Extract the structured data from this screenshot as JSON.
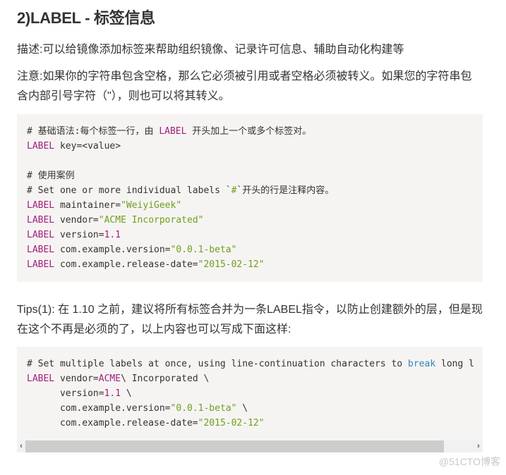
{
  "heading": "2)LABEL - 标签信息",
  "description": "描述:可以给镜像添加标签来帮助组织镜像、记录许可信息、辅助自动化构建等",
  "note": "注意:如果你的字符串包含空格，那么它必须被引用或者空格必须被转义。如果您的字符串包含内部引号字符（\"），则也可以将其转义。",
  "code1": {
    "l1_comment": "# 基础语法:每个标签一行，由 ",
    "l1_kw": "LABEL",
    "l1_rest": " 开头加上一个或多个标签对。",
    "l2_kw": "LABEL",
    "l2_rest": " key=<value>",
    "l4": "# 使用案例",
    "l5_a": "# Set one or more individual labels `",
    "l5_b": "#",
    "l5_c": "`开头的行是注释内容。",
    "lines": [
      {
        "kw": "LABEL",
        "key": " maintainer=",
        "val": "\"WeiyiGeek\""
      },
      {
        "kw": "LABEL",
        "key": " vendor=",
        "val": "\"ACME Incorporated\""
      },
      {
        "kw": "LABEL",
        "key": " version=",
        "val": "1.1"
      },
      {
        "kw": "LABEL",
        "key": " com.example.version=",
        "val": "\"0.0.1-beta\""
      },
      {
        "kw": "LABEL",
        "key": " com.example.release-date=",
        "val": "\"2015-02-12\""
      }
    ]
  },
  "tips": "Tips(1): 在 1.10 之前，建议将所有标签合并为一条LABEL指令，以防止创建额外的层，但是现在这个不再是必须的了，以上内容也可以写成下面这样:",
  "code2": {
    "l1_a": "# Set multiple labels at once, using line-continuation characters to ",
    "l1_b": "break",
    "l1_c": " long l",
    "l2_kw": "LABEL",
    "l2_a": " vendor=",
    "l2_b": "ACME",
    "l2_c": "\\ Incorporated \\",
    "l3_a": "      version=",
    "l3_b": "1.1",
    "l3_c": " \\",
    "l4_a": "      com.example.version=",
    "l4_b": "\"0.0.1-beta\"",
    "l4_c": " \\",
    "l5_a": "      com.example.release-date=",
    "l5_b": "\"2015-02-12\""
  },
  "scrollbar": {
    "left": "‹",
    "right": "›",
    "position_fraction": 0.0,
    "visible_fraction": 0.91
  },
  "watermark": "@51CTO博客"
}
